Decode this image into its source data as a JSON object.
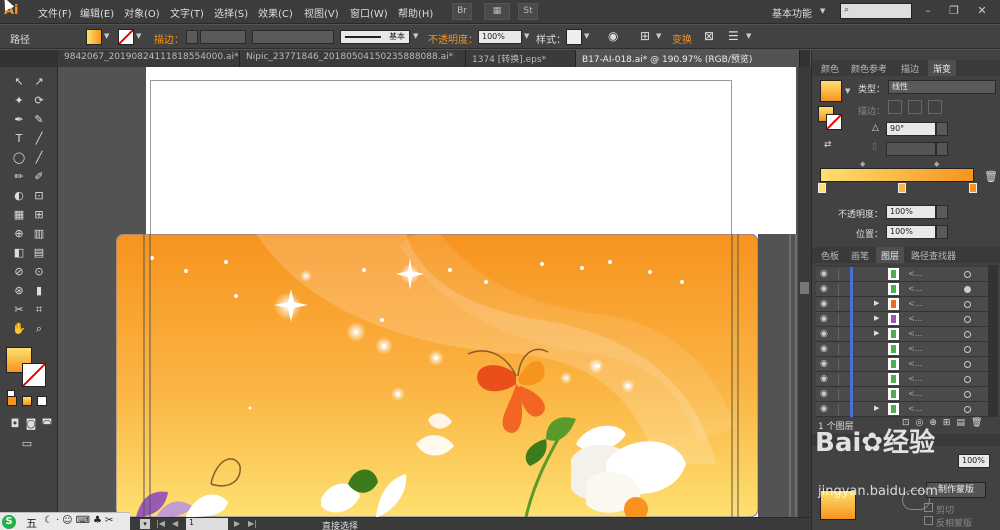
{
  "app": {
    "logo": "Ai",
    "workspace": "基本功能",
    "search_placeholder": ""
  },
  "menu": [
    "文件(F)",
    "编辑(E)",
    "对象(O)",
    "文字(T)",
    "选择(S)",
    "效果(C)",
    "视图(V)",
    "窗口(W)",
    "帮助(H)"
  ],
  "menu_buttons": [
    "Br",
    "▦",
    "St"
  ],
  "window_buttons": [
    "–",
    "❐",
    "✕"
  ],
  "control": {
    "selection": "路径",
    "stroke_label": "描边：",
    "stroke_style": "基本",
    "opacity_label": "不透明度：",
    "opacity_value": "100%",
    "style_label": "样式：",
    "transform_label": "变换"
  },
  "tabs": [
    {
      "label": "9842067_20190824111818554000.ai* @",
      "active": false
    },
    {
      "label": "Nipic_23771846_20180504150235888088.ai*",
      "active": false
    },
    {
      "label": "1374 [转换].eps*",
      "active": false
    },
    {
      "label": "B17-AI-018.ai* @ 190.97% (RGB/预览)",
      "active": true
    }
  ],
  "tools": [
    "↖",
    "↗",
    "✦",
    "⟳",
    "✒",
    "✎",
    "T",
    "╱",
    "◯",
    "╱",
    "✏",
    "✐",
    "◐",
    "⊡",
    "▦",
    "⊞",
    "⊕",
    "▥",
    "◧",
    "▤",
    "⊘",
    "⊙",
    "⊛",
    "▮",
    "✂",
    "⌗",
    "✋",
    "⌕"
  ],
  "gradient_panel": {
    "tabs": [
      "颜色",
      "颜色参考",
      "描边",
      "渐变"
    ],
    "type_label": "类型：",
    "type_value": "线性",
    "stroke_label": "描边：",
    "angle_value": "90°",
    "opacity_label": "不透明度：",
    "opacity_value": "100%",
    "position_label": "位置：",
    "position_value": "100%",
    "colors": {
      "start": "#fde070",
      "end": "#f7931e"
    }
  },
  "layers_panel": {
    "tabs": [
      "色板",
      "画笔",
      "图层",
      "路径查找器"
    ],
    "row_count": 10,
    "footer": "1 个图层"
  },
  "transparency_panel": {
    "value": "100%",
    "make_mask_label": "制作蒙版",
    "clip_label": "剪切",
    "invert_label": "反相蒙版"
  },
  "status": {
    "zoom": "190.97",
    "page": "1",
    "tool_name": "直接选择"
  },
  "ime": {
    "label": "五"
  },
  "watermark": {
    "text": "Bai✿经验",
    "sub": "jingyan.baidu.com"
  }
}
